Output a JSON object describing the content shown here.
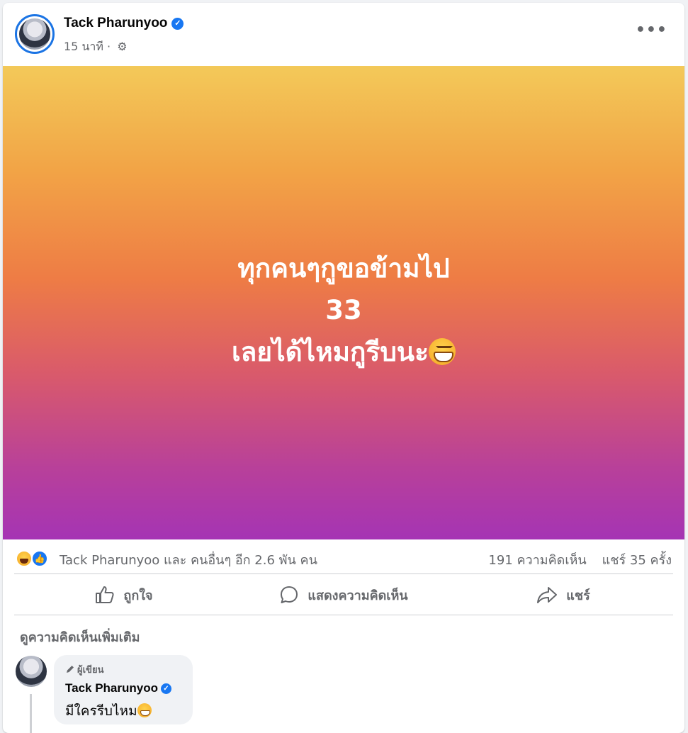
{
  "post": {
    "author": "Tack Pharunyoo",
    "verified_icon": "verified-badge-icon",
    "time": "15 นาที",
    "separator": "·",
    "audience_icon": "gear-icon",
    "more_label": "•••",
    "text_lines": [
      "ทุกคนๆกูขอข้ามไป",
      "33",
      "เลยได้ไหมกูรีบนะ"
    ],
    "trailing_emoji": "grinning-face-emoji",
    "background_colors": [
      "#f3c959",
      "#ee7c45",
      "#a534b4"
    ]
  },
  "stats": {
    "reaction_icons": [
      "haha-reaction-icon",
      "like-reaction-icon"
    ],
    "likes_text": "Tack Pharunyoo และ คนอื่นๆ อีก 2.6 พัน คน",
    "comments": "191 ความคิดเห็น",
    "shares": "แชร์ 35 ครั้ง"
  },
  "actions": {
    "like": "ถูกใจ",
    "comment": "แสดงความคิดเห็น",
    "share": "แชร์"
  },
  "comments_section": {
    "view_more": "ดูความคิดเห็นเพิ่มเติม",
    "comment": {
      "badge": "ผู้เขียน",
      "author": "Tack Pharunyoo",
      "text": "มีใครรีบไหม"
    }
  },
  "colors": {
    "brand": "#1877f2",
    "secondary_text": "#65676b",
    "primary_text": "#050505"
  }
}
